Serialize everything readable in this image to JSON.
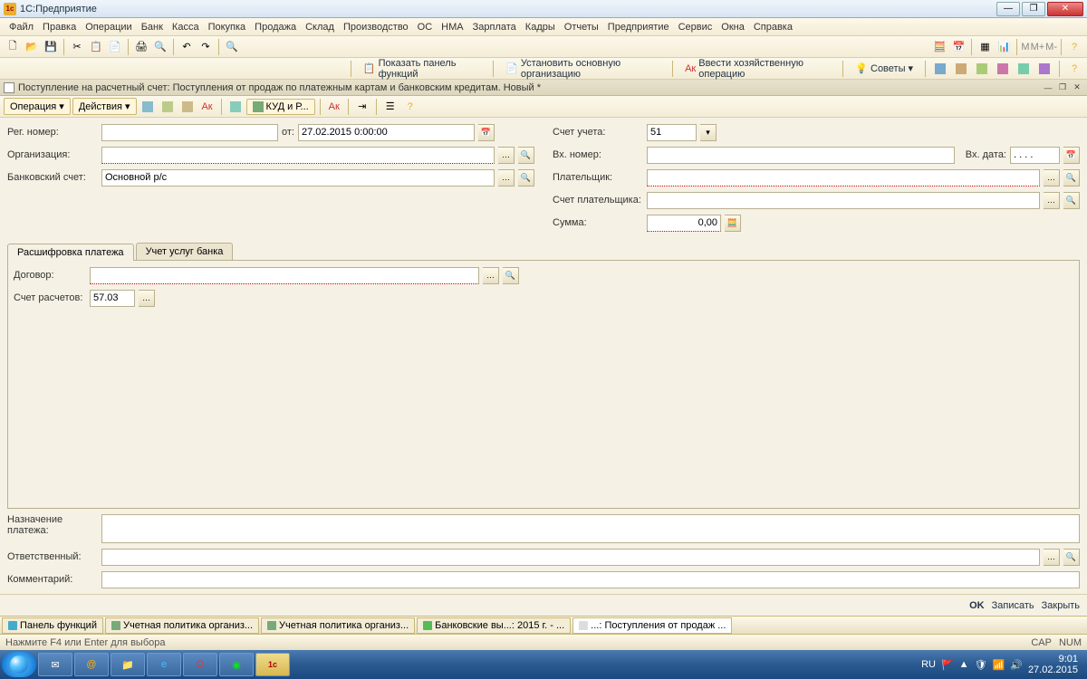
{
  "titlebar": {
    "app": "1С:Предприятие"
  },
  "menu": [
    "Файл",
    "Правка",
    "Операции",
    "Банк",
    "Касса",
    "Покупка",
    "Продажа",
    "Склад",
    "Производство",
    "ОС",
    "НМА",
    "Зарплата",
    "Кадры",
    "Отчеты",
    "Предприятие",
    "Сервис",
    "Окна",
    "Справка"
  ],
  "toolbar2": {
    "show_panel": "Показать панель функций",
    "set_org": "Установить основную организацию",
    "enter_op": "Ввести хозяйственную операцию",
    "advice": "Советы"
  },
  "doc": {
    "title": "Поступление на расчетный счет: Поступления от продаж по платежным картам и банковским кредитам. Новый *",
    "toolbar": {
      "operation": "Операция",
      "actions": "Действия",
      "kudir": "КУД и Р..."
    }
  },
  "form": {
    "reg_num_lbl": "Рег. номер:",
    "ot_lbl": "от:",
    "date_val": "27.02.2015  0:00:00",
    "org_lbl": "Организация:",
    "bank_acc_lbl": "Банковский счет:",
    "bank_acc_val": "Основной р/с",
    "acct_lbl": "Счет учета:",
    "acct_val": "51",
    "in_num_lbl": "Вх. номер:",
    "in_date_lbl": "Вх. дата:",
    "in_date_val": ". .  .  .",
    "payer_lbl": "Плательщик:",
    "payer_acct_lbl": "Счет плательщика:",
    "sum_lbl": "Сумма:",
    "sum_val": "0,00"
  },
  "tabs": {
    "t1": "Расшифровка платежа",
    "t2": "Учет услуг банка"
  },
  "tab1": {
    "contract_lbl": "Договор:",
    "settl_acct_lbl": "Счет расчетов:",
    "settl_acct_val": "57.03"
  },
  "bottom": {
    "purpose_lbl": "Назначение\nплатежа:",
    "resp_lbl": "Ответственный:",
    "comment_lbl": "Комментарий:"
  },
  "doc_buttons": {
    "ok": "OK",
    "write": "Записать",
    "close": "Закрыть"
  },
  "wtabs": [
    "Панель функций",
    "Учетная политика организ...",
    "Учетная политика организ...",
    "Банковские вы...: 2015 г. - ...",
    "...: Поступления от продаж ..."
  ],
  "status": {
    "hint": "Нажмите F4 или Enter для выбора",
    "cap": "CAP",
    "num": "NUM"
  },
  "tray": {
    "lang": "RU",
    "time": "9:01",
    "date": "27.02.2015"
  }
}
